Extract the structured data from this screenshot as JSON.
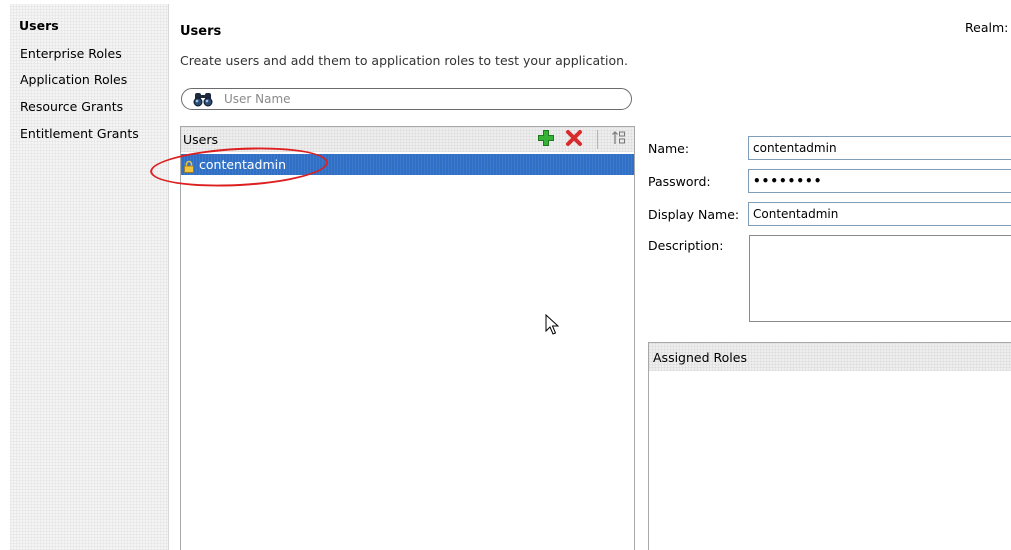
{
  "sidebar": {
    "items": [
      {
        "label": "Users",
        "active": true
      },
      {
        "label": "Enterprise Roles"
      },
      {
        "label": "Application Roles"
      },
      {
        "label": "Resource Grants"
      },
      {
        "label": "Entitlement Grants"
      }
    ]
  },
  "main": {
    "title": "Users",
    "description": "Create users and add them to application roles to test your application.",
    "realm_label": "Realm:"
  },
  "search": {
    "placeholder": "User Name",
    "value": "",
    "icon": "binoculars-icon"
  },
  "users_list": {
    "header": "Users",
    "toolbar": [
      {
        "name": "add-user",
        "icon": "plus-icon",
        "color": "#2eaa2e"
      },
      {
        "name": "delete-user",
        "icon": "x-icon",
        "color": "#d92b2b"
      },
      {
        "name": "sort",
        "icon": "sort-icon"
      }
    ],
    "rows": [
      {
        "label": "contentadmin",
        "icon": "lock-icon",
        "selected": true
      }
    ],
    "selection_color": "#2f6fc6"
  },
  "details": {
    "name_label": "Name:",
    "name_value": "contentadmin",
    "password_label": "Password:",
    "password_value": "••••••••",
    "display_name_label": "Display Name:",
    "display_name_value": "Contentadmin",
    "description_label": "Description:",
    "description_value": ""
  },
  "assigned_roles": {
    "header": "Assigned Roles"
  },
  "annotation": {
    "color": "#dd1f1f"
  }
}
